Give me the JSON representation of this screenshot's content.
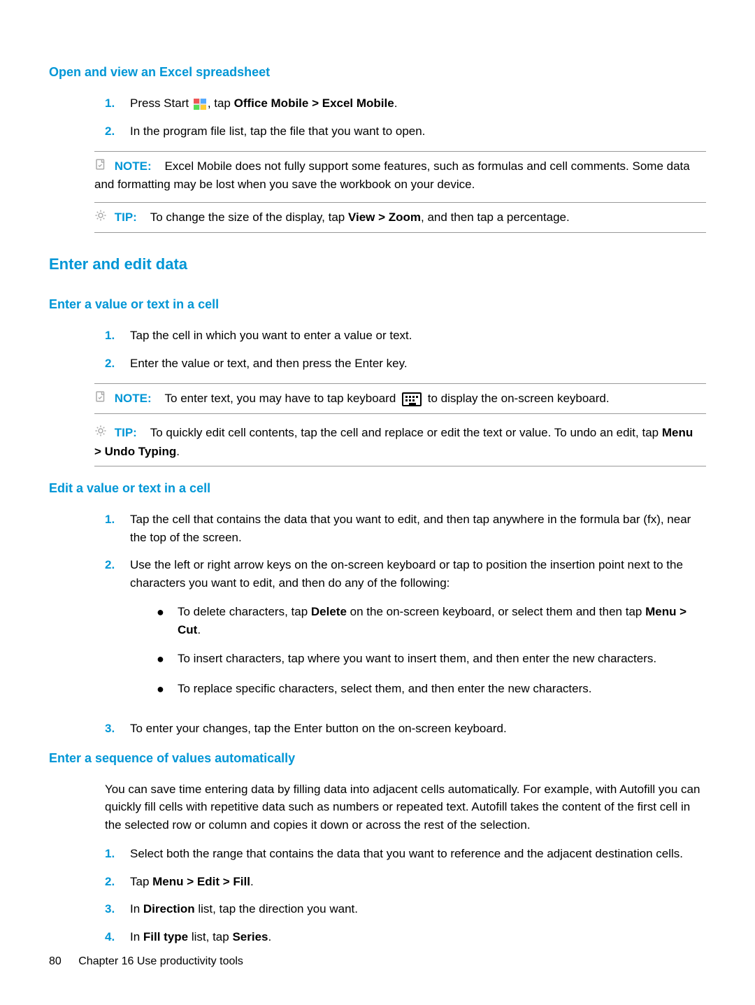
{
  "sections": {
    "s1": {
      "heading": "Open and view an Excel spreadsheet",
      "step1_a": "Press Start ",
      "step1_b": ", tap ",
      "step1_bold": "Office Mobile > Excel Mobile",
      "step1_c": ".",
      "step2": "In the program file list, tap the file that you want to open.",
      "note_label": "NOTE:",
      "note_text": "Excel Mobile does not fully support some features, such as formulas and cell comments. Some data and formatting may be lost when you save the workbook on your device.",
      "tip_label": "TIP:",
      "tip_a": "To change the size of the display, tap ",
      "tip_bold": "View > Zoom",
      "tip_b": ", and then tap a percentage."
    },
    "h2": "Enter and edit data",
    "s2": {
      "heading": "Enter a value or text in a cell",
      "step1": "Tap the cell in which you want to enter a value or text.",
      "step2": "Enter the value or text, and then press the Enter key.",
      "note_label": "NOTE:",
      "note_a": "To enter text, you may have to tap keyboard ",
      "note_b": " to display the on-screen keyboard.",
      "tip_label": "TIP:",
      "tip_a": "To quickly edit cell contents, tap the cell and replace or edit the text or value. To undo an edit, tap ",
      "tip_bold": "Menu > Undo Typing",
      "tip_b": "."
    },
    "s3": {
      "heading": "Edit a value or text in a cell",
      "step1": "Tap the cell that contains the data that you want to edit, and then tap anywhere in the formula bar (fx), near the top of the screen.",
      "step2": "Use the left or right arrow keys on the on-screen keyboard or tap to position the insertion point next to the characters you want to edit, and then do any of the following:",
      "b1_a": "To delete characters, tap ",
      "b1_bold1": "Delete",
      "b1_b": " on the on-screen keyboard, or select them and then tap ",
      "b1_bold2": "Menu > Cut",
      "b1_c": ".",
      "b2": "To insert characters, tap where you want to insert them, and then enter the new characters.",
      "b3": "To replace specific characters, select them, and then enter the new characters.",
      "step3": "To enter your changes, tap the Enter button on the on-screen keyboard."
    },
    "s4": {
      "heading": "Enter a sequence of values automatically",
      "intro": "You can save time entering data by filling data into adjacent cells automatically. For example, with Autofill you can quickly fill cells with repetitive data such as numbers or repeated text. Autofill takes the content of the first cell in the selected row or column and copies it down or across the rest of the selection.",
      "step1": "Select both the range that contains the data that you want to reference and the adjacent destination cells.",
      "step2_a": "Tap ",
      "step2_bold": "Menu > Edit > Fill",
      "step2_b": ".",
      "step3_a": "In ",
      "step3_bold": "Direction",
      "step3_b": " list, tap the direction you want.",
      "step4_a": "In ",
      "step4_bold1": "Fill type",
      "step4_b": " list, tap ",
      "step4_bold2": "Series",
      "step4_c": "."
    }
  },
  "footer": {
    "page": "80",
    "chapter": "Chapter 16   Use productivity tools"
  },
  "nums": {
    "n1": "1.",
    "n2": "2.",
    "n3": "3.",
    "n4": "4."
  }
}
